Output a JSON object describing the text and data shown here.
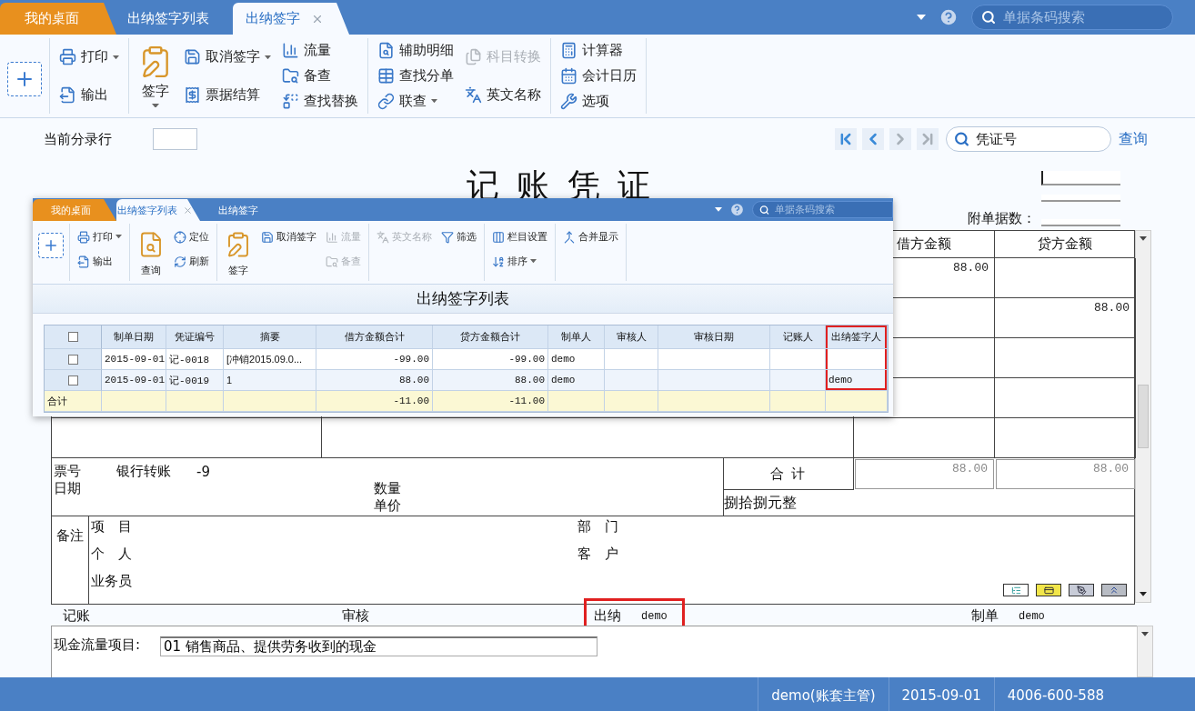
{
  "tabs": [
    {
      "kind": "home",
      "label": "我的桌面",
      "selected": false,
      "closable": false
    },
    {
      "kind": "page",
      "label": "出纳签字列表",
      "selected": false,
      "closable": false
    },
    {
      "kind": "page",
      "label": "出纳签字",
      "selected": true,
      "closable": true
    }
  ],
  "search": {
    "placeholder": "单据条码搜索"
  },
  "toolbar": {
    "groups": [
      [
        [
          {
            "kind": "add"
          }
        ]
      ],
      [
        [
          {
            "kind": "small",
            "label": "打印",
            "disabled": false,
            "dropdown": true
          },
          {
            "kind": "small",
            "label": "输出",
            "disabled": false,
            "dropdown": false
          }
        ]
      ],
      [
        [
          {
            "kind": "big",
            "label": "签字",
            "disabled": false,
            "dropdown": true
          }
        ],
        [
          {
            "kind": "small",
            "label": "取消签字",
            "disabled": false,
            "dropdown": true
          },
          {
            "kind": "small",
            "label": "票据结算",
            "disabled": false,
            "dropdown": false
          }
        ],
        [
          {
            "kind": "small",
            "label": "流量",
            "disabled": false,
            "dropdown": false
          },
          {
            "kind": "small",
            "label": "备查",
            "disabled": false,
            "dropdown": false
          },
          {
            "kind": "small",
            "label": "查找替换",
            "disabled": false,
            "dropdown": false
          }
        ]
      ],
      [
        [
          {
            "kind": "small",
            "label": "辅助明细",
            "disabled": false,
            "dropdown": false
          },
          {
            "kind": "small",
            "label": "查找分单",
            "disabled": false,
            "dropdown": false
          },
          {
            "kind": "small",
            "label": "联查",
            "disabled": false,
            "dropdown": true
          }
        ],
        [
          {
            "kind": "small",
            "label": "科目转换",
            "disabled": true,
            "dropdown": false
          },
          {
            "kind": "small",
            "label": "英文名称",
            "disabled": false,
            "dropdown": false
          }
        ]
      ],
      [
        [
          {
            "kind": "small",
            "label": "计算器",
            "disabled": false,
            "dropdown": false
          },
          {
            "kind": "small",
            "label": "会计日历",
            "disabled": false,
            "dropdown": false
          },
          {
            "kind": "small",
            "label": "选项",
            "disabled": false,
            "dropdown": false
          }
        ]
      ]
    ]
  },
  "header": {
    "current_entry_label": "当前分录行",
    "nav": [
      {
        "kind": "first",
        "disabled": false
      },
      {
        "kind": "prev",
        "disabled": false
      },
      {
        "kind": "next",
        "disabled": true
      },
      {
        "kind": "last",
        "disabled": true
      }
    ],
    "voucher_search": {
      "placeholder": "凭证号"
    },
    "query_link": "查询"
  },
  "voucher": {
    "title": "记 账 凭 证",
    "attachments_label": "附单据数：",
    "columns": [
      "借方金额",
      "贷方金额"
    ],
    "rows": [
      {
        "debit": "88.00"
      },
      {
        "credit": "88.00"
      },
      {},
      {},
      {}
    ],
    "ticket": {
      "ticket_no_label": "票号",
      "ticket_type": "银行转账",
      "ticket_no": "-9",
      "date_label": "日期",
      "quantity_label": "数量",
      "price_label": "单价"
    },
    "total": {
      "label": "合 计",
      "debit": "88.00",
      "credit": "88.00",
      "in_words": "捌拾捌元整"
    },
    "remarks": {
      "label": "备注",
      "left": [
        "项　目",
        "个　人",
        "业务员"
      ],
      "right": [
        "部　门",
        "客　户"
      ]
    },
    "signatures": [
      {
        "label": "记账",
        "highlight": false
      },
      {
        "label": "审核",
        "highlight": false
      },
      {
        "label": "出纳",
        "value": "demo",
        "highlight": true
      },
      {
        "label": "制单",
        "value": "demo",
        "highlight": false
      }
    ],
    "cash_flow": {
      "label": "现金流量项目:",
      "value": "01 销售商品、提供劳务收到的现金"
    }
  },
  "inset": {
    "tabs": [
      {
        "kind": "home",
        "label": "我的桌面",
        "selected": false,
        "closable": false
      },
      {
        "kind": "page",
        "label": "出纳签字列表",
        "selected": true,
        "closable": true
      },
      {
        "kind": "page",
        "label": "出纳签字",
        "selected": false,
        "closable": false
      }
    ],
    "search": {
      "placeholder": "单据条码搜索"
    },
    "toolbar": {
      "groups": [
        [
          [
            {
              "kind": "add"
            }
          ]
        ],
        [
          [
            {
              "kind": "small",
              "label": "打印",
              "disabled": false,
              "dropdown": true
            },
            {
              "kind": "small",
              "label": "输出",
              "disabled": false,
              "dropdown": false
            }
          ]
        ],
        [
          [
            {
              "kind": "big",
              "label": "查询",
              "disabled": false,
              "dropdown": false
            }
          ],
          [
            {
              "kind": "small",
              "label": "定位",
              "disabled": false,
              "dropdown": false
            },
            {
              "kind": "small",
              "label": "刷新",
              "disabled": false,
              "dropdown": false
            }
          ]
        ],
        [
          [
            {
              "kind": "big",
              "label": "签字",
              "disabled": false,
              "dropdown": false
            }
          ],
          [
            {
              "kind": "small",
              "label": "取消签字",
              "disabled": false,
              "dropdown": false
            }
          ],
          [
            {
              "kind": "small",
              "label": "流量",
              "disabled": true,
              "dropdown": false
            },
            {
              "kind": "small",
              "label": "备查",
              "disabled": true,
              "dropdown": false
            }
          ]
        ],
        [
          [
            {
              "kind": "small",
              "label": "英文名称",
              "disabled": true,
              "dropdown": false
            }
          ],
          [
            {
              "kind": "small",
              "label": "筛选",
              "disabled": false,
              "dropdown": false
            }
          ]
        ],
        [
          [
            {
              "kind": "small",
              "label": "栏目设置",
              "disabled": false,
              "dropdown": false
            },
            {
              "kind": "small",
              "label": "排序",
              "disabled": false,
              "dropdown": true
            }
          ]
        ],
        [
          [
            {
              "kind": "small",
              "label": "合并显示",
              "disabled": false,
              "dropdown": false
            }
          ]
        ]
      ]
    },
    "title": "出纳签字列表",
    "table": {
      "select_all": {
        "checked": false
      },
      "columns": [
        {
          "label": "制单日期",
          "highlight": false
        },
        {
          "label": "凭证编号",
          "highlight": false
        },
        {
          "label": "摘要",
          "highlight": false
        },
        {
          "label": "借方金额合计",
          "highlight": false
        },
        {
          "label": "贷方金额合计",
          "highlight": false
        },
        {
          "label": "制单人",
          "highlight": false
        },
        {
          "label": "审核人",
          "highlight": false
        },
        {
          "label": "审核日期",
          "highlight": false
        },
        {
          "label": "记账人",
          "highlight": false
        },
        {
          "label": "出纳签字人",
          "highlight": true
        }
      ],
      "rows": [
        {
          "checked": false,
          "date": "2015-09-01",
          "voucher_no": "记-0018",
          "summary": "[冲销2015.09.0...",
          "debit_total": "-99.00",
          "credit_total": "-99.00",
          "maker": "demo"
        },
        {
          "checked": false,
          "date": "2015-09-01",
          "voucher_no": "记-0019",
          "summary": "1",
          "debit_total": "88.00",
          "credit_total": "88.00",
          "maker": "demo",
          "cashier_signer": "demo"
        }
      ],
      "total": {
        "label": "合计",
        "debit_total": "-11.00",
        "credit_total": "-11.00"
      }
    }
  },
  "status_bar": [
    "demo(账套主管)",
    "2015-09-01",
    "4006-600-588"
  ]
}
